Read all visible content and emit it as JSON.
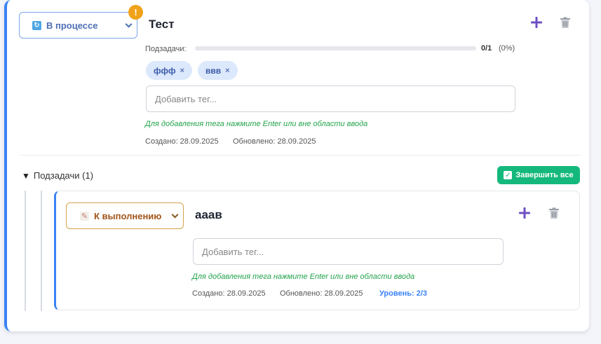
{
  "task": {
    "status": "В процессе",
    "status_icon": "refresh-icon",
    "warning_badge": "!",
    "title": "Тест",
    "subtasks_label": "Подзадачи:",
    "progress_count": "0/1",
    "progress_pct": "(0%)",
    "progress_fraction": 0,
    "tags": [
      {
        "label": "ффф",
        "remove": "×"
      },
      {
        "label": "ввв",
        "remove": "×"
      }
    ],
    "tag_placeholder": "Добавить тег...",
    "tag_hint": "Для добавления тега нажмите Enter или вне области ввода",
    "created": "Создано: 28.09.2025",
    "updated": "Обновлено: 28.09.2025"
  },
  "subtasks_section": {
    "toggle": "▼",
    "label": "Подзадачи (1)",
    "complete_all": "Завершить все",
    "complete_all_check": "✓"
  },
  "subtask": {
    "status": "К выполнению",
    "status_icon": "memo-icon",
    "title": "ааав",
    "tag_placeholder": "Добавить тег...",
    "tag_hint": "Для добавления тега нажмите Enter или вне области ввода",
    "created": "Создано: 28.09.2025",
    "updated": "Обновлено: 28.09.2025",
    "level": "Уровень: 2/3"
  },
  "colors": {
    "accent": "#3b82f6",
    "add_icon": "#6d4fc4",
    "success": "#14b87c",
    "warning": "#f0a21a",
    "hint": "#22a34a"
  }
}
